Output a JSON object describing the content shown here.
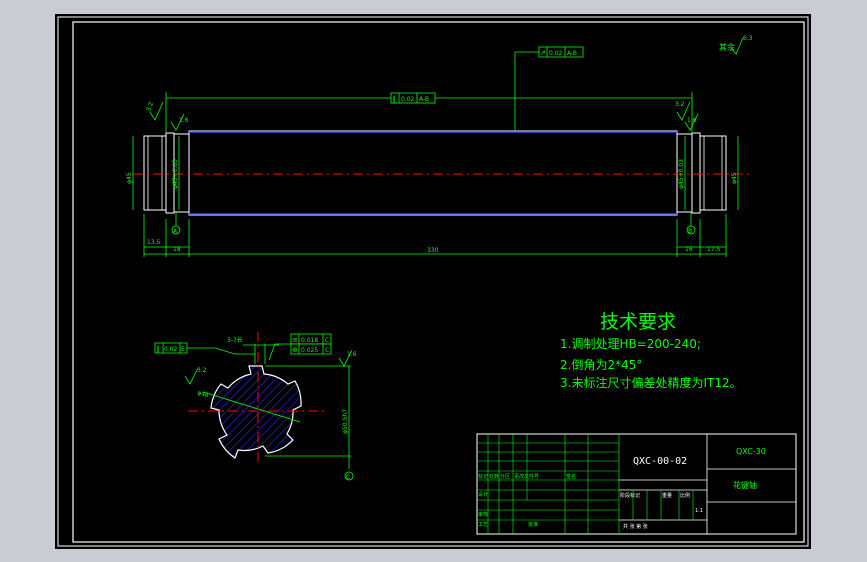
{
  "drawing": {
    "top_view": {
      "runout_frame": {
        "symbol": "↗",
        "tol": "0.02",
        "datum": "A-B"
      },
      "parallel_frame": {
        "symbol": "∥",
        "tol": "0.02",
        "datum": "A-B"
      },
      "roughness_other": "其余",
      "roughness_other_val": "6.3",
      "roughness_left": "3.2",
      "roughness_left2": "1.6",
      "roughness_right": "3.2",
      "roughness_right2": "1.6",
      "dia_left_outer": "φ45",
      "dia_left_inner": "φ45+0.03",
      "dia_right_outer": "φ45",
      "dia_right_inner": "φ45+0.03",
      "datum_left": "A",
      "datum_right": "B",
      "dim_left_end": "13.5",
      "dim_left_shoulder": "18",
      "dim_total": "330",
      "dim_right_shoulder": "16",
      "dim_right_end": "17.5"
    },
    "section_view": {
      "parallel_frame": {
        "symbol": "∥",
        "tol": "0.02",
        "datum": "E"
      },
      "keyway_label": "3-7长",
      "sym_frame": {
        "symbol": "≡",
        "tol": "0.018",
        "datum": "C"
      },
      "pos_frame": {
        "symbol": "⊕",
        "tol": "0.025",
        "datum": "C"
      },
      "roughness": "3.2",
      "roughness2": "1.6",
      "spline_label": "φ46",
      "dia_label": "φ50.5h7",
      "datum": "C"
    },
    "tech_requirements": {
      "title": "技术要求",
      "items": [
        "1.调制处理HB=200-240;",
        "2.倒角为2*45°",
        "3.未标注尺寸偏差处精度为IT12。"
      ]
    },
    "title_block": {
      "drawing_no": "QXC-00-02",
      "assembly_no": "QXC-30",
      "part_name": "花键轴",
      "row_labels": [
        "标记",
        "处数",
        "分区",
        "更改文件号",
        "签名"
      ],
      "stage_labels": [
        "阶段标记",
        "重量",
        "比例"
      ],
      "ratio": "1:1",
      "sheet_info": "共 张 第 张",
      "designer_labels": [
        "设计",
        "审核",
        "工艺",
        "批准"
      ]
    }
  },
  "colors": {
    "background": "#000000",
    "frame": "#ffffff",
    "dimension": "#00ff00",
    "centerline": "#ff0000",
    "body_edge": "#4040ff",
    "hatch": "#3030ff",
    "text_white": "#ffffff",
    "section_outline": "#ffffff"
  }
}
